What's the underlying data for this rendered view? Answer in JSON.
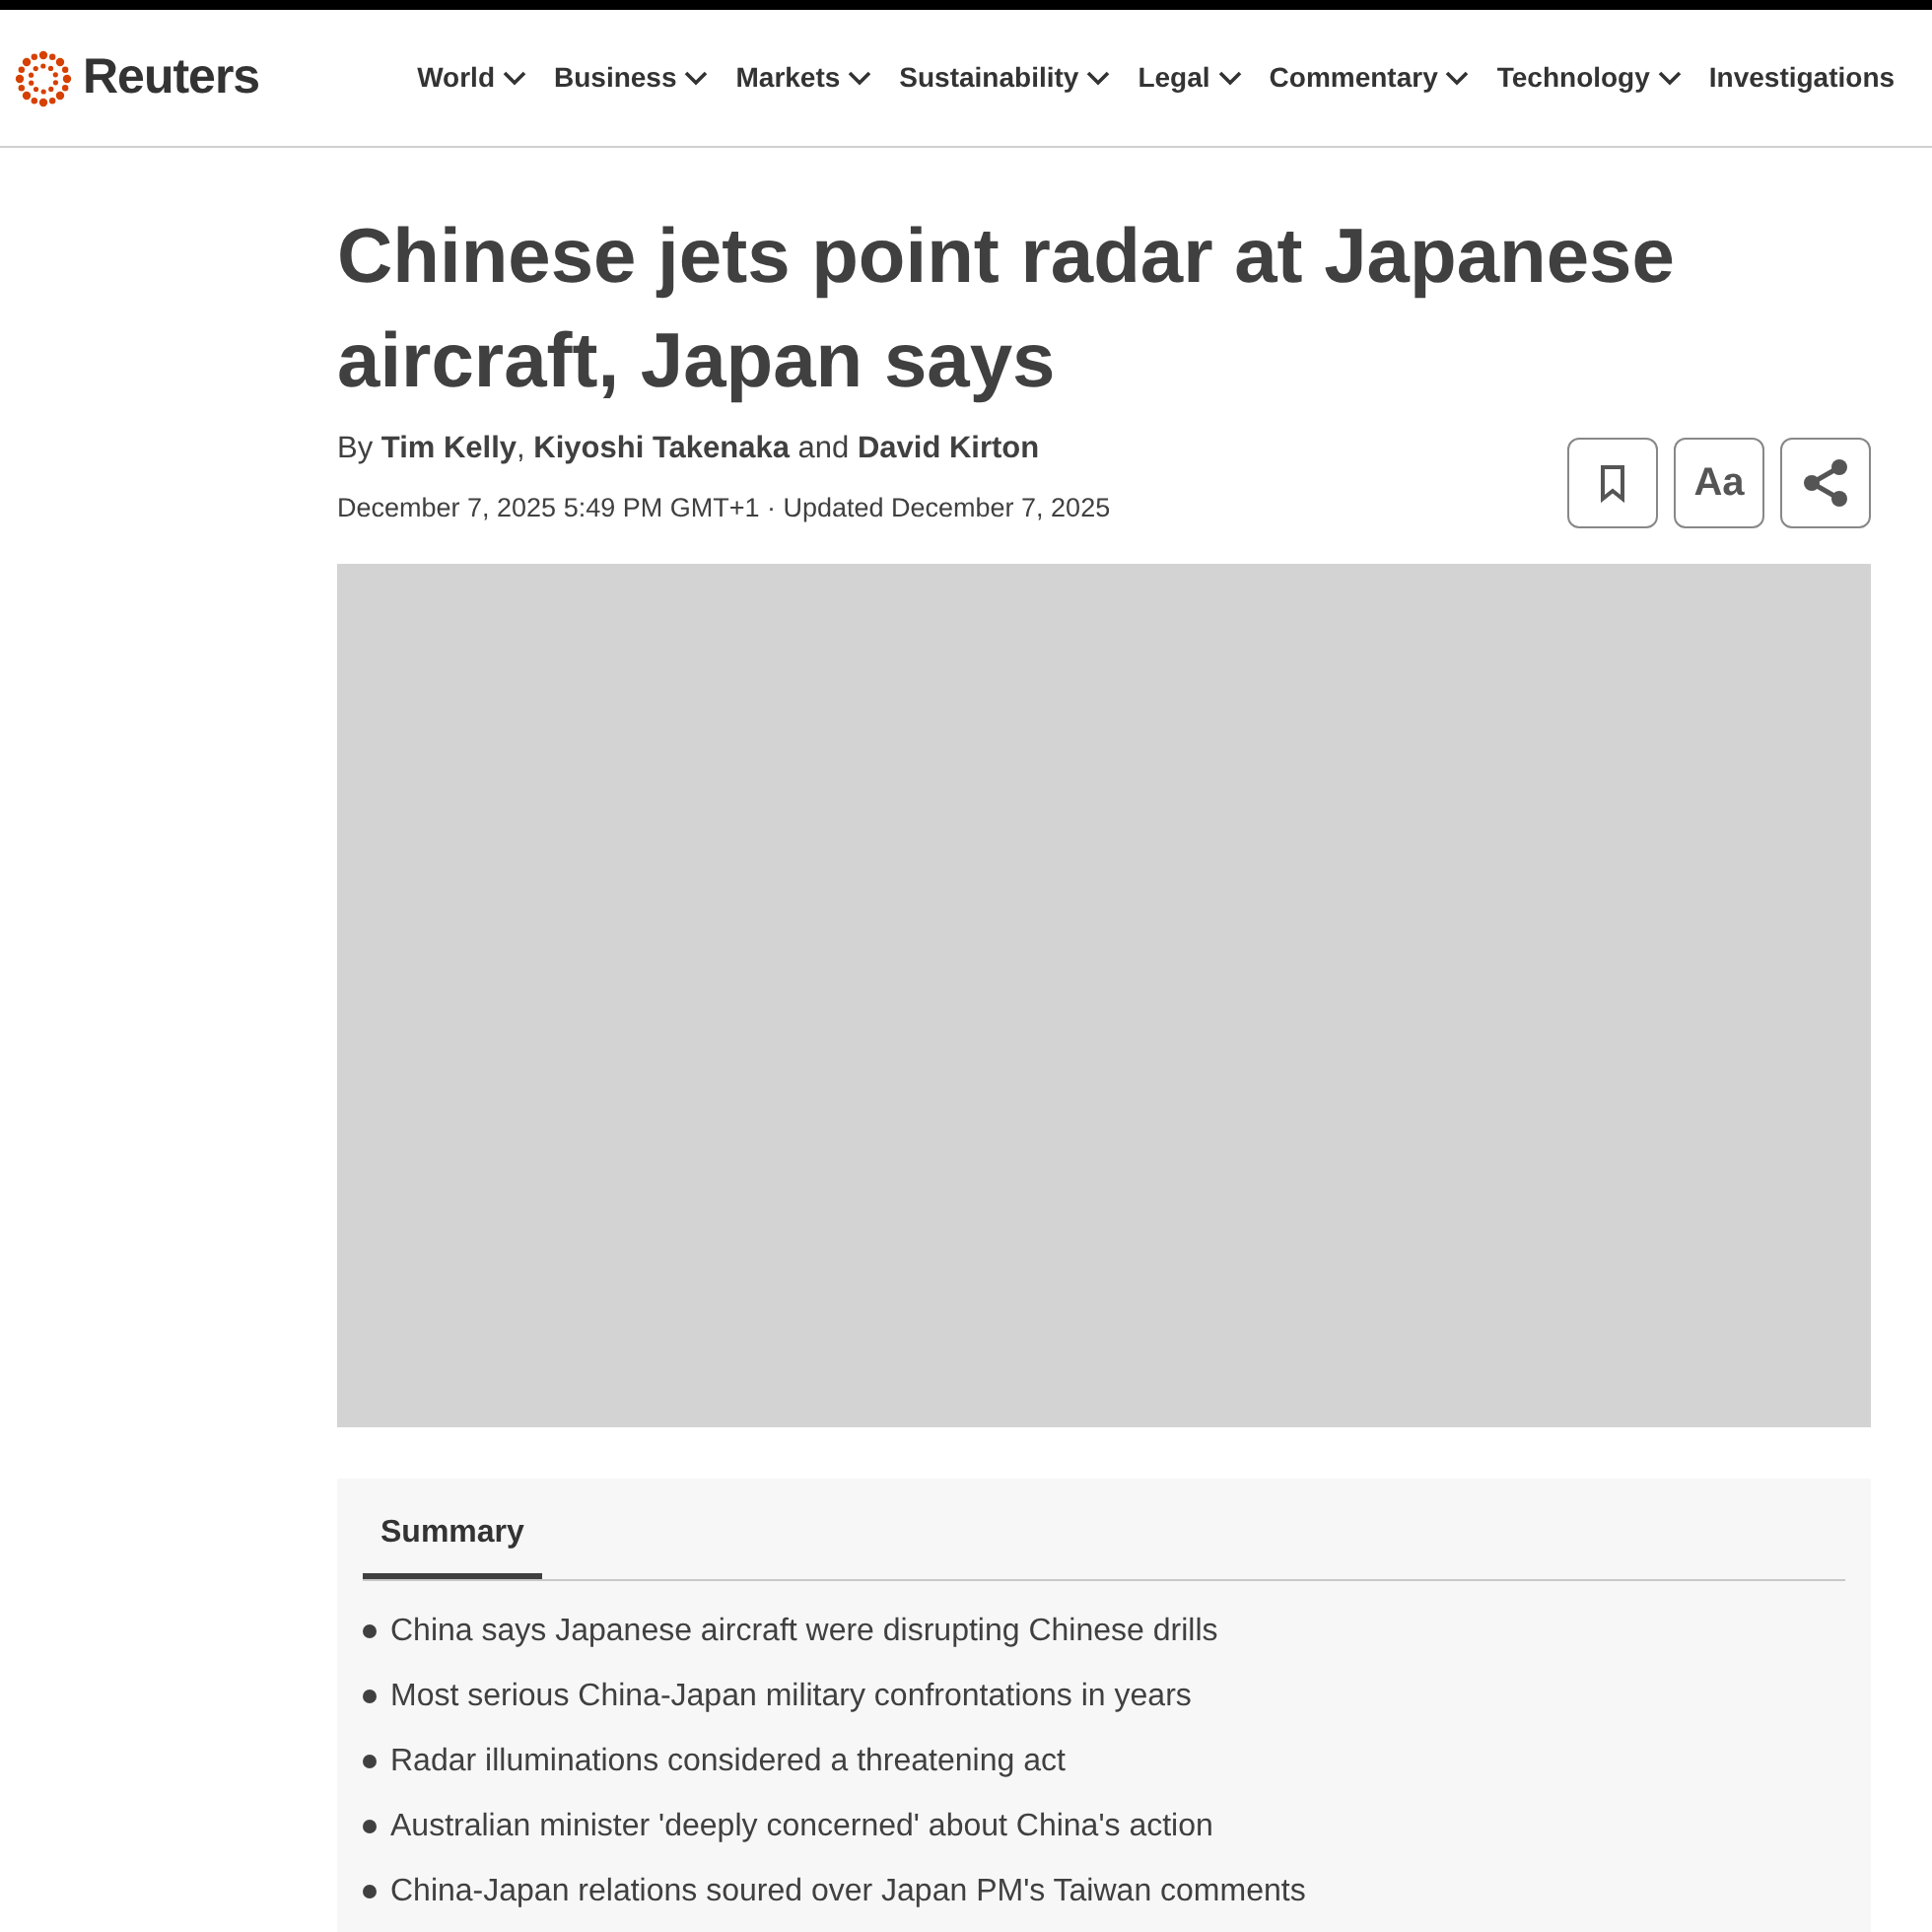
{
  "header": {
    "logo": "Reuters",
    "nav": [
      {
        "label": "World",
        "dropdown": true
      },
      {
        "label": "Business",
        "dropdown": true
      },
      {
        "label": "Markets",
        "dropdown": true
      },
      {
        "label": "Sustainability",
        "dropdown": true
      },
      {
        "label": "Legal",
        "dropdown": true
      },
      {
        "label": "Commentary",
        "dropdown": true
      },
      {
        "label": "Technology",
        "dropdown": true
      },
      {
        "label": "Investigations",
        "dropdown": false
      }
    ]
  },
  "article": {
    "headline": "Chinese jets point radar at Japanese aircraft, Japan says",
    "byline": "By **Tim Kelly**, **Kiyoshi Takenaka** and **David Kirton**",
    "dateline": "December 7, 2025 5:49 PM GMT+1 · Updated December 7, 2025",
    "actions": [
      {
        "kind": "bookmark"
      },
      {
        "kind": "font-size",
        "label": "Aa"
      },
      {
        "kind": "share"
      }
    ],
    "image": {
      "kind": "placeholder"
    },
    "summary": {
      "tabs": [
        {
          "label": "Summary",
          "selected": true
        }
      ],
      "bullets": [
        "China says Japanese aircraft were disrupting Chinese drills",
        "Most serious China-Japan military confrontations in years",
        "Radar illuminations considered a threatening act",
        "Australian minister 'deeply concerned' about China's action",
        "China-Japan relations soured over Japan PM's Taiwan comments"
      ]
    }
  }
}
